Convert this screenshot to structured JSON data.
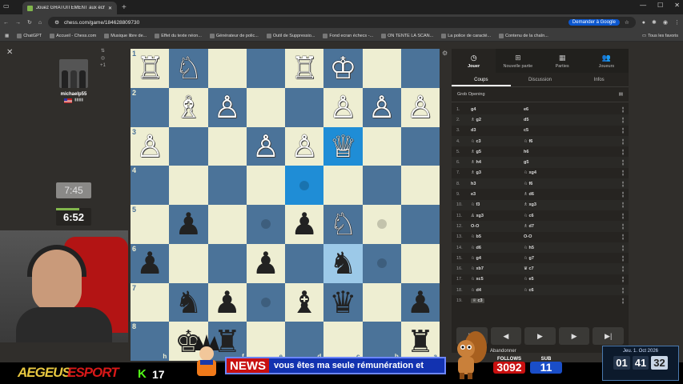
{
  "browser": {
    "tab_title": "Jouez GRATUITEMENT aux échecs",
    "url": "chess.com/game/184628809730",
    "google_button": "Demander à Google",
    "bookmarks": [
      "ChatGPT",
      "Accueil - Chess.com",
      "Musique libre de...",
      "Effet du texte néon...",
      "Générateur de polic...",
      "Outil de Suppressio...",
      "Fond ecran échecs -...",
      "ON TENTE LA SCAN...",
      "La police de caracté...",
      "Contenu de la chaîn..."
    ],
    "all_bookmarks": "Tous les favoris"
  },
  "player": {
    "username": "michaelp55",
    "rating": "▮▮▮▮",
    "clock_opponent": "7:45",
    "clock_self": "6:52",
    "clock_self_bar_fraction": 0.65,
    "side_icons": [
      "⇅",
      "◎",
      "+1"
    ]
  },
  "board": {
    "rank_labels": [
      "1",
      "2",
      "3",
      "4",
      "5",
      "6",
      "7",
      "8"
    ],
    "file_labels": [
      "h",
      "g",
      "f",
      "e",
      "d",
      "c",
      "b",
      "a"
    ],
    "rows": [
      [
        "♖",
        "♘",
        "",
        "",
        "♖",
        "♔",
        "",
        ""
      ],
      [
        "",
        "♗",
        "♙",
        "",
        "",
        "♙",
        "♙",
        "♙"
      ],
      [
        "♙",
        "",
        "",
        "♙",
        "♙",
        "♕",
        "",
        ""
      ],
      [
        "",
        "",
        "",
        "",
        "",
        "",
        "",
        ""
      ],
      [
        "",
        "♟",
        "",
        "",
        "♟",
        "♘",
        "",
        ""
      ],
      [
        "♟",
        "",
        "",
        "♟",
        "",
        "♞",
        "",
        ""
      ],
      [
        "",
        "♞",
        "♟",
        "",
        "♝",
        "♛",
        "",
        "♟"
      ],
      [
        "",
        "♚",
        "♜",
        "",
        "",
        "",
        "",
        "♜"
      ]
    ],
    "piece_colors": [
      [
        "w",
        "w",
        "",
        "",
        "w",
        "w",
        "",
        ""
      ],
      [
        "",
        "w",
        "w",
        "",
        "",
        "w",
        "w",
        "w"
      ],
      [
        "w",
        "",
        "",
        "w",
        "w",
        "w",
        "",
        ""
      ],
      [
        "",
        "",
        "",
        "",
        "",
        "",
        "",
        ""
      ],
      [
        "",
        "b",
        "",
        "",
        "b",
        "w",
        "",
        ""
      ],
      [
        "b",
        "",
        "",
        "b",
        "",
        "b",
        "",
        ""
      ],
      [
        "",
        "b",
        "b",
        "",
        "b",
        "b",
        "",
        "b"
      ],
      [
        "",
        "b",
        "b",
        "",
        "",
        "",
        "",
        "b"
      ]
    ],
    "highlights": [
      [
        2,
        5
      ],
      [
        3,
        4
      ],
      [
        5,
        5
      ]
    ],
    "dots": [
      [
        3,
        4
      ],
      [
        4,
        3
      ],
      [
        4,
        6
      ],
      [
        5,
        6
      ],
      [
        6,
        3
      ]
    ]
  },
  "panel": {
    "tabs": [
      {
        "label": "Jouer",
        "icon": "◷"
      },
      {
        "label": "Nouvelle partie",
        "icon": "⊞"
      },
      {
        "label": "Parties",
        "icon": "▦"
      },
      {
        "label": "Joueurs",
        "icon": "👥"
      }
    ],
    "subtabs": [
      "Coups",
      "Discussion",
      "Infos"
    ],
    "opening": "Grob Opening",
    "moves": [
      {
        "n": "1.",
        "w": "g4",
        "b": "e6"
      },
      {
        "n": "2.",
        "w": "♗ g2",
        "b": "d5"
      },
      {
        "n": "3.",
        "w": "d3",
        "b": "c5"
      },
      {
        "n": "4.",
        "w": "♘ c3",
        "b": "♘ f6"
      },
      {
        "n": "5.",
        "w": "♗ g5",
        "b": "h6"
      },
      {
        "n": "6.",
        "w": "♗ h4",
        "b": "g5"
      },
      {
        "n": "7.",
        "w": "♗ g3",
        "b": "♘ xg4"
      },
      {
        "n": "8.",
        "w": "h3",
        "b": "♘ f6"
      },
      {
        "n": "9.",
        "w": "e3",
        "b": "♗ d6"
      },
      {
        "n": "10.",
        "w": "♘ f3",
        "b": "♗ xg3"
      },
      {
        "n": "11.",
        "w": "♙ xg3",
        "b": "♘ c6"
      },
      {
        "n": "12.",
        "w": "O-O",
        "b": "♗ d7"
      },
      {
        "n": "13.",
        "w": "♘ b5",
        "b": "O-O"
      },
      {
        "n": "14.",
        "w": "♘ d6",
        "b": "♘ h5"
      },
      {
        "n": "15.",
        "w": "♘ g4",
        "b": "♘ g7"
      },
      {
        "n": "16.",
        "w": "♘ xb7",
        "b": "♛ c7"
      },
      {
        "n": "17.",
        "w": "♘ xc5",
        "b": "♘ e5"
      },
      {
        "n": "18.",
        "w": "♘ d4",
        "b": "♘ c6"
      },
      {
        "n": "19.",
        "w": "♕ c3",
        "b": ""
      }
    ],
    "nav": [
      "|◀",
      "◀",
      "▶",
      "▶",
      "▶|"
    ],
    "resign": "Abandonner"
  },
  "overlay": {
    "logo_a": "AEGEUS",
    "logo_b": "ESPORT",
    "kick_icon": "K",
    "kick_count": "17",
    "news_tag": "NEWS",
    "news_text": "vous êtes ma seule rémunération et",
    "follows_label": "FOLLOWS",
    "follows_count": "3092",
    "subs_label": "SUB",
    "subs_count": "11",
    "date": "Jeu. 1. Oct 2026",
    "hh": "01",
    "mm": "41",
    "ss": "32"
  }
}
